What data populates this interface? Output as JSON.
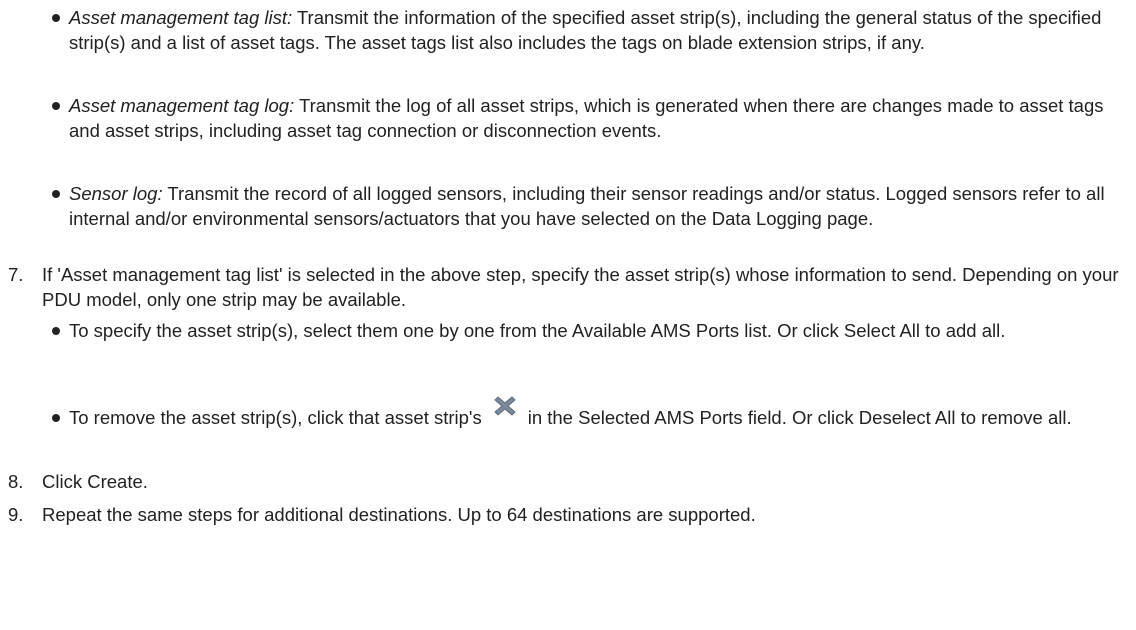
{
  "sub_bullets_step6": [
    {
      "term": "Asset management tag list:",
      "text": " Transmit the information of the specified asset strip(s), including the general status of the specified strip(s) and a list of asset tags. The asset tags list also includes the tags on blade extension strips, if any."
    },
    {
      "term": "Asset management tag log:",
      "text": " Transmit the log of all asset strips, which is generated when there are changes made to asset tags and asset strips, including asset tag connection or disconnection events."
    },
    {
      "term": "Sensor log:",
      "text": " Transmit the record of all logged sensors, including their sensor readings and/or status. Logged sensors refer to all internal and/or environmental sensors/actuators that you have selected on the Data Logging page."
    }
  ],
  "steps": [
    {
      "number": "7.",
      "text": "If 'Asset management tag list' is selected in the above step, specify the asset strip(s) whose information to send. Depending on your PDU model, only one strip may be available."
    },
    {
      "number": "8.",
      "text": "Click Create."
    },
    {
      "number": "9.",
      "text": "Repeat the same steps for additional destinations. Up to 64 destinations are supported."
    }
  ],
  "sub_bullets_step7": [
    {
      "text": "To specify the asset strip(s), select them one by one from the Available AMS Ports list. Or click Select All to add all."
    },
    {
      "text_before_icon": "To remove the asset strip(s), click that asset strip's",
      "icon": "remove-x-icon",
      "text_after_icon": "in the Selected AMS Ports field. Or click Deselect All to remove all."
    }
  ],
  "colors": {
    "text": "#222222",
    "icon_fill": "#7a8a99"
  }
}
